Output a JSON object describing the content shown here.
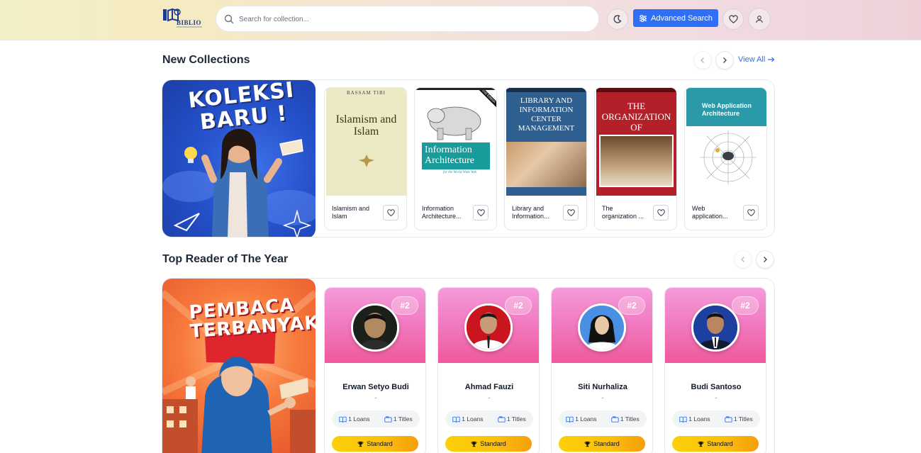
{
  "header": {
    "logo_text": "BIBLIO",
    "search_placeholder": "Search for collection...",
    "advanced_search_label": "Advanced Search",
    "icons": [
      "theme-toggle-icon",
      "heart-icon",
      "user-icon",
      "search-icon",
      "sliders-icon"
    ]
  },
  "new_collections": {
    "title": "New Collections",
    "view_all_label": "View All",
    "promo_text": [
      "KOLEKSI",
      "BARU !"
    ],
    "books": [
      {
        "title": "Islamism and Islam",
        "cover_author": "BASSAM TIBI",
        "cover_title": "Islamism and Islam"
      },
      {
        "title": "Information Architecture...",
        "cover_title": "Information Architecture",
        "cover_subtitle": "for the World Wide Web",
        "cover_badge": "2nd Edition"
      },
      {
        "title": "Library and Information...",
        "cover_title": "LIBRARY AND INFORMATION CENTER MANAGEMENT"
      },
      {
        "title": "The organization ...",
        "cover_title": "THE ORGANIZATION OF INFORMATION"
      },
      {
        "title": "Web application...",
        "cover_title": "Web Application Architecture"
      }
    ]
  },
  "top_readers": {
    "title": "Top Reader of The Year",
    "promo_text": [
      "PEMBACA",
      "TERBANYAK"
    ],
    "readers": [
      {
        "rank": "#2",
        "name": "Erwan Setyo Budi",
        "sub": "-",
        "loans": "1 Loans",
        "titles": "1 Titles",
        "badge": "Standard"
      },
      {
        "rank": "#2",
        "name": "Ahmad Fauzi",
        "sub": "-",
        "loans": "1 Loans",
        "titles": "1 Titles",
        "badge": "Standard"
      },
      {
        "rank": "#2",
        "name": "Siti Nurhaliza",
        "sub": "-",
        "loans": "1 Loans",
        "titles": "1 Titles",
        "badge": "Standard"
      },
      {
        "rank": "#2",
        "name": "Budi Santoso",
        "sub": "-",
        "loans": "1 Loans",
        "titles": "1 Titles",
        "badge": "Standard"
      }
    ]
  },
  "colors": {
    "accent": "#2f6ff5",
    "reader_gradient_top": "#f59bd9",
    "reader_gradient_bottom": "#f0599b",
    "badge_gold": "#fbbf0c"
  }
}
